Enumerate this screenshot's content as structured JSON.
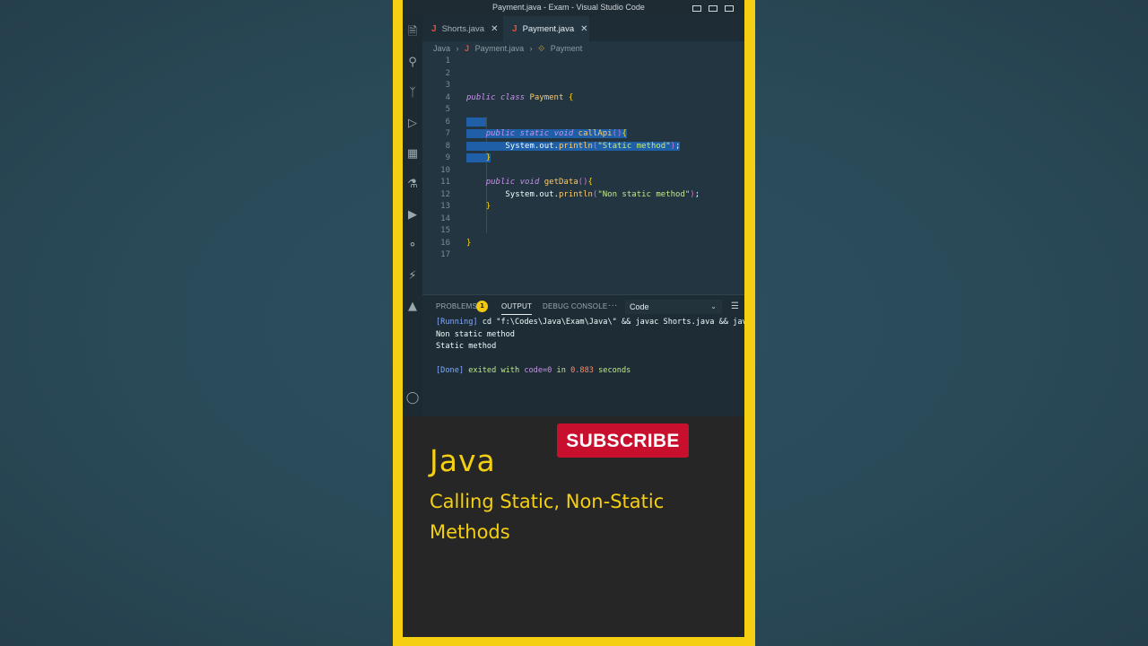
{
  "window": {
    "title": "Payment.java - Exam - Visual Studio Code"
  },
  "tabs": [
    {
      "label": "Shorts.java",
      "active": false
    },
    {
      "label": "Payment.java",
      "active": true
    }
  ],
  "breadcrumb": {
    "folder": "Java",
    "file": "Payment.java",
    "symbol": "Payment"
  },
  "editor": {
    "line_numbers": [
      "1",
      "2",
      "3",
      "4",
      "5",
      "6",
      "7",
      "8",
      "9",
      "10",
      "11",
      "12",
      "13",
      "14",
      "15",
      "16",
      "17"
    ],
    "lines": [
      "",
      "",
      "",
      "public class Payment {",
      "",
      "",
      "    public static void callApi(){",
      "        System.out.println(\"Static method\");",
      "    }",
      "",
      "    public void getData(){",
      "        System.out.println(\"Non static method\");",
      "    }",
      "",
      "",
      "}",
      ""
    ]
  },
  "panel": {
    "tabs": {
      "problems": "PROBLEMS",
      "output": "OUTPUT",
      "debug_console": "DEBUG CONSOLE",
      "more": "···"
    },
    "problems_count": "1",
    "channel": "Code",
    "output": {
      "running_tag": "[Running]",
      "running_cmd": " cd \"f:\\Codes\\Java\\Exam\\Java\\\" && javac Shorts.java && java Shorts",
      "line1": "Non static method",
      "line2": "Static method",
      "done_tag": "[Done]",
      "done_text1": " exited with ",
      "done_code": "code=0",
      "done_text2": " in ",
      "done_secs": "0.883",
      "done_text3": " seconds"
    }
  },
  "promo": {
    "subscribe": "SUBSCRIBE",
    "title": "Java",
    "subtitle": "Calling Static, Non-Static Methods"
  },
  "colors": {
    "frame": "#f5cf12",
    "subscribe_bg": "#c8102e",
    "editor_bg": "#223540",
    "selection": "#1f5fa8"
  }
}
